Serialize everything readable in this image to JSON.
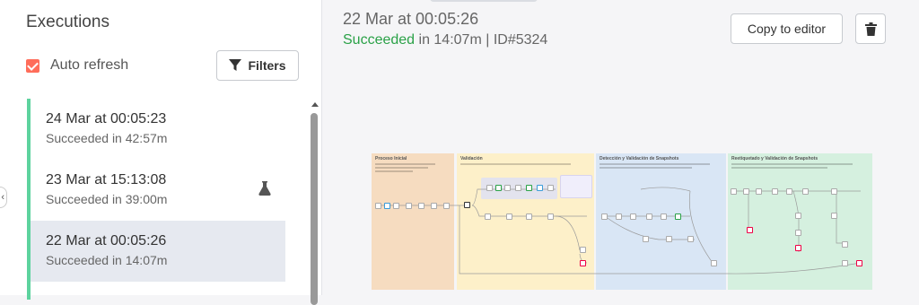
{
  "sidebar": {
    "title": "Executions",
    "auto_refresh_label": "Auto refresh",
    "filters_label": "Filters",
    "executions": [
      {
        "date": "24 Mar at 00:05:23",
        "status": "Succeeded in 42:57m"
      },
      {
        "date": "23 Mar at 15:13:08",
        "status": "Succeeded in 39:00m"
      },
      {
        "date": "22 Mar at 00:05:26",
        "status": "Succeeded in 14:07m"
      }
    ]
  },
  "main": {
    "title": "22 Mar at 00:05:26",
    "status_word": "Succeeded",
    "status_rest": " in 14:07m | ID#5324",
    "copy_label": "Copy to editor"
  },
  "workflow": {
    "sections": [
      {
        "title": "Proceso Inicial",
        "color": "#f6dcc0"
      },
      {
        "title": "Validación",
        "color": "#fdf0c9"
      },
      {
        "title": "Detección y Validación de Snapshots",
        "color": "#d9e6f5"
      },
      {
        "title": "Reetiquetado y Validación de Snapshots",
        "color": "#d5f0df"
      }
    ]
  },
  "colors": {
    "accent": "#ff6d5a",
    "success": "#2aa147",
    "execution_marker": "#5dd39e",
    "selected_row": "#e6e9f0"
  }
}
